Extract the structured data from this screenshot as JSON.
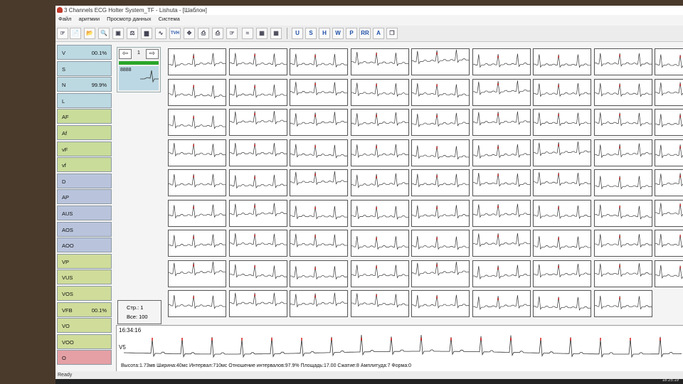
{
  "window": {
    "title": "3 Channels ECG Holter System_TF - Lishuta - [Шаблон]"
  },
  "menu": [
    "Файл",
    "аритмии",
    "Просмотр данных",
    "Система"
  ],
  "toolbar": {
    "icons": [
      "hand-icon",
      "new-file-icon",
      "open-folder-icon",
      "zoom-icon",
      "image-icon",
      "chart-tool-icon",
      "histogram-icon",
      "wave-icon",
      "tvh-icon",
      "fit-icon",
      "print-icon",
      "printer-icon",
      "export-icon",
      "filter-icon",
      "scale-icon",
      "rhythm-icon"
    ],
    "tvh_label": "TVH",
    "letter_buttons": [
      "U",
      "S",
      "H",
      "W",
      "P",
      "RR",
      "A"
    ]
  },
  "categories": [
    {
      "label": "V",
      "pct": "00.1%",
      "color": "#bcd9e2"
    },
    {
      "label": "S",
      "pct": "",
      "color": "#bcd9e2"
    },
    {
      "label": "N",
      "pct": "99.9%",
      "color": "#bcd9e2"
    },
    {
      "label": "L",
      "pct": "",
      "color": "#bcd9e2"
    },
    {
      "label": "AF",
      "pct": "",
      "color": "#c9dc9a"
    },
    {
      "label": "Af",
      "pct": "",
      "color": "#c9dc9a"
    },
    {
      "label": "vF",
      "pct": "",
      "color": "#c9dc9a"
    },
    {
      "label": "vf",
      "pct": "",
      "color": "#c9dc9a"
    },
    {
      "label": "D",
      "pct": "",
      "color": "#b9c4dc"
    },
    {
      "label": "AP",
      "pct": "",
      "color": "#b9c4dc"
    },
    {
      "label": "AUS",
      "pct": "",
      "color": "#b9c4dc"
    },
    {
      "label": "AOS",
      "pct": "",
      "color": "#b9c4dc"
    },
    {
      "label": "AOO",
      "pct": "",
      "color": "#b9c4dc"
    },
    {
      "label": "VP",
      "pct": "",
      "color": "#cfdc9a"
    },
    {
      "label": "VUS",
      "pct": "",
      "color": "#cfdc9a"
    },
    {
      "label": "VOS",
      "pct": "",
      "color": "#cfdc9a"
    },
    {
      "label": "VFB",
      "pct": "00.1%",
      "color": "#cfdc9a"
    },
    {
      "label": "VO",
      "pct": "",
      "color": "#cfdc9a"
    },
    {
      "label": "VOO",
      "pct": "",
      "color": "#cfdc9a"
    },
    {
      "label": "O",
      "pct": "",
      "color": "#e4a0a4"
    }
  ],
  "navigator": {
    "page": "1",
    "count": "8888"
  },
  "page_info": {
    "page": "Стр.: 1",
    "total": "Все: 100"
  },
  "strip": {
    "time": "16:34:16",
    "lead": "V5",
    "stats": "Высота:1.73мв  Ширина:40мс  Интервал:710мс  Отношение интервалов:97.9%  Площадь:17.00  Сжатие:8  Амплитуда:7  Форма:0"
  },
  "status": {
    "text": "Ready",
    "clock": "18:25:19"
  }
}
